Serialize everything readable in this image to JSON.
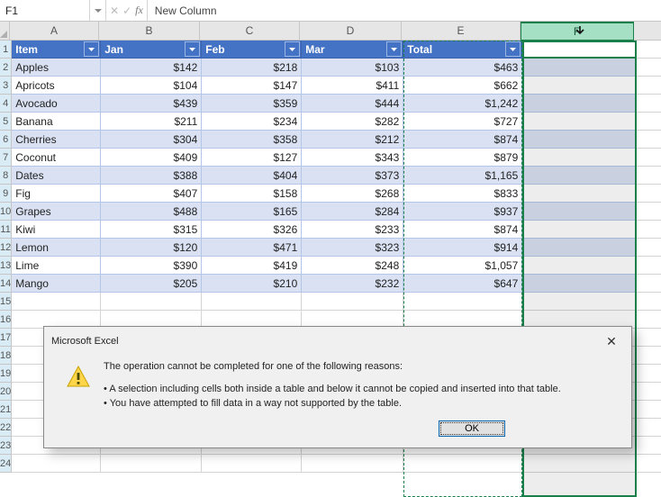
{
  "nameBox": "F1",
  "formula": "New Column",
  "columns": [
    "A",
    "B",
    "C",
    "D",
    "E",
    "F"
  ],
  "headers": [
    "Item",
    "Jan",
    "Feb",
    "Mar",
    "Total",
    "New Column"
  ],
  "rows": [
    {
      "item": "Apples",
      "jan": "$142",
      "feb": "$218",
      "mar": "$103",
      "total": "$463"
    },
    {
      "item": "Apricots",
      "jan": "$104",
      "feb": "$147",
      "mar": "$411",
      "total": "$662"
    },
    {
      "item": "Avocado",
      "jan": "$439",
      "feb": "$359",
      "mar": "$444",
      "total": "$1,242"
    },
    {
      "item": "Banana",
      "jan": "$211",
      "feb": "$234",
      "mar": "$282",
      "total": "$727"
    },
    {
      "item": "Cherries",
      "jan": "$304",
      "feb": "$358",
      "mar": "$212",
      "total": "$874"
    },
    {
      "item": "Coconut",
      "jan": "$409",
      "feb": "$127",
      "mar": "$343",
      "total": "$879"
    },
    {
      "item": "Dates",
      "jan": "$388",
      "feb": "$404",
      "mar": "$373",
      "total": "$1,165"
    },
    {
      "item": "Fig",
      "jan": "$407",
      "feb": "$158",
      "mar": "$268",
      "total": "$833"
    },
    {
      "item": "Grapes",
      "jan": "$488",
      "feb": "$165",
      "mar": "$284",
      "total": "$937"
    },
    {
      "item": "Kiwi",
      "jan": "$315",
      "feb": "$326",
      "mar": "$233",
      "total": "$874"
    },
    {
      "item": "Lemon",
      "jan": "$120",
      "feb": "$471",
      "mar": "$323",
      "total": "$914"
    },
    {
      "item": "Lime",
      "jan": "$390",
      "feb": "$419",
      "mar": "$248",
      "total": "$1,057"
    },
    {
      "item": "Mango",
      "jan": "$205",
      "feb": "$210",
      "mar": "$232",
      "total": "$647"
    }
  ],
  "visibleRowCount": 24,
  "dialog": {
    "title": "Microsoft Excel",
    "head": "The operation cannot be completed for one of the following reasons:",
    "bullet1": "A selection including cells both inside a table and below it cannot be copied and inserted into that table.",
    "bullet2": "You have attempted to fill data in a way not supported by the table.",
    "ok": "OK"
  }
}
